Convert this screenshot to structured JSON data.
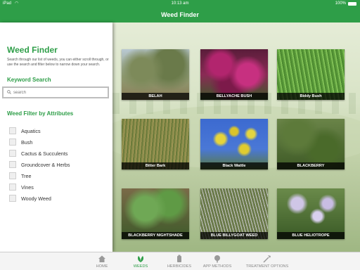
{
  "status_bar": {
    "carrier": "iPad",
    "time": "10:13 am",
    "battery": "100%"
  },
  "nav": {
    "title": "Weed Finder"
  },
  "sidebar": {
    "title": "Weed Finder",
    "description": "Search through our list of weeds, you can either scroll through, or use the search and filter below to narrow down your search.",
    "keyword_heading": "Keyword Search",
    "search_placeholder": "search",
    "filter_heading": "Weed Filter by Attributes",
    "filters": [
      "Aquatics",
      "Bush",
      "Cactus & Succulents",
      "Groundcover & Herbs",
      "Tree",
      "Vines",
      "Woody Weed"
    ]
  },
  "weeds": [
    "BELAH",
    "BELLYACHE BUSH",
    "Biddy Bush",
    "Bitter Bark",
    "Black Wattle",
    "BLACKBERRY",
    "BLACKBERRY NIGHTSHADE",
    "BLUE BILLYGOAT WEED",
    "BLUE HELIOTROPE"
  ],
  "tabs": [
    {
      "label": "HOME",
      "icon": "house-icon"
    },
    {
      "label": "WEEDS",
      "icon": "leaf-icon"
    },
    {
      "label": "HERBICIDES",
      "icon": "bottle-icon"
    },
    {
      "label": "APP METHODS",
      "icon": "tree-icon"
    },
    {
      "label": "TREATMENT OPTIONS",
      "icon": "sprayer-icon"
    }
  ],
  "active_tab": "WEEDS",
  "colors": {
    "brand_green": "#2e9e48",
    "caption_bg": "#000000"
  }
}
